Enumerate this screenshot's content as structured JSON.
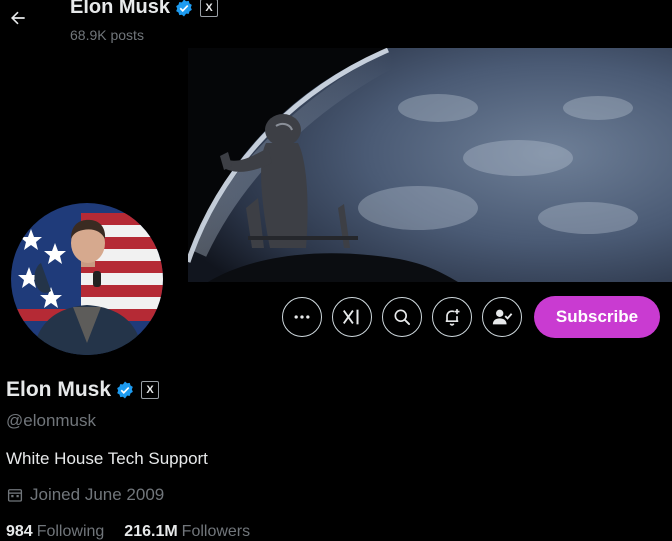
{
  "header": {
    "name": "Elon Musk",
    "posts_count": "68.9K posts",
    "back_icon": "arrow-left-icon"
  },
  "profile": {
    "name": "Elon Musk",
    "handle": "@elonmusk",
    "bio": "White House Tech Support",
    "joined": "Joined June 2009",
    "verified_icon": "verified-badge-icon",
    "affiliate_badge": "X",
    "following_count": "984",
    "following_label": "Following",
    "followers_count": "216.1M",
    "followers_label": "Followers"
  },
  "actions": {
    "more_icon": "more-icon",
    "grok_icon": "grok-icon",
    "search_icon": "search-icon",
    "notify_icon": "bell-plus-icon",
    "following_icon": "person-check-icon",
    "subscribe_label": "Subscribe"
  },
  "colors": {
    "background": "#000000",
    "verified_blue": "#1d9bf0",
    "subscribe": "#c93bd1",
    "secondary_text": "#71767b"
  }
}
